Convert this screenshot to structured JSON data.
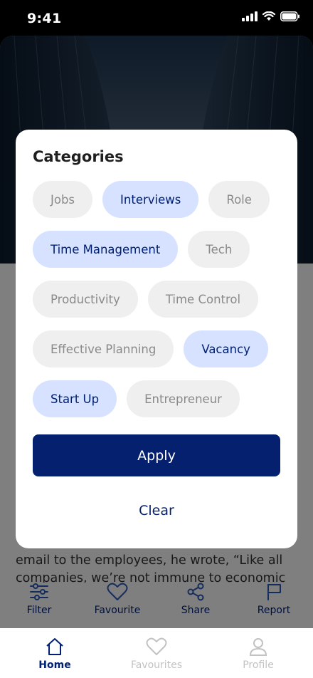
{
  "status": {
    "time": "9:41"
  },
  "article": {
    "lines": [
      "email to the employees, he wrote, “Like all",
      "companies, we’re not immune to economic"
    ]
  },
  "actions": [
    {
      "label": "Filter",
      "icon": "filter-icon"
    },
    {
      "label": "Favourite",
      "icon": "heart-icon"
    },
    {
      "label": "Share",
      "icon": "share-icon"
    },
    {
      "label": "Report",
      "icon": "flag-icon"
    }
  ],
  "modal": {
    "title": "Categories",
    "rows": [
      [
        {
          "label": "Jobs",
          "selected": false
        },
        {
          "label": "Interviews",
          "selected": true
        },
        {
          "label": "Role",
          "selected": false
        }
      ],
      [
        {
          "label": "Time Management",
          "selected": true
        },
        {
          "label": "Tech",
          "selected": false
        }
      ],
      [
        {
          "label": "Productivity",
          "selected": false
        },
        {
          "label": "Time Control",
          "selected": false
        }
      ],
      [
        {
          "label": "Effective Planning",
          "selected": false
        },
        {
          "label": "Vacancy",
          "selected": true
        }
      ],
      [
        {
          "label": "Start Up",
          "selected": true
        },
        {
          "label": "Entrepreneur",
          "selected": false
        }
      ]
    ],
    "apply_label": "Apply",
    "clear_label": "Clear"
  },
  "tabs": [
    {
      "label": "Home",
      "icon": "home-icon",
      "active": true
    },
    {
      "label": "Favourites",
      "icon": "heart-icon",
      "active": false
    },
    {
      "label": "Profile",
      "icon": "user-icon",
      "active": false
    }
  ],
  "colors": {
    "primary": "#04206f",
    "chip_selected": "#d6e2ff",
    "chip_unselected": "#efefef"
  }
}
